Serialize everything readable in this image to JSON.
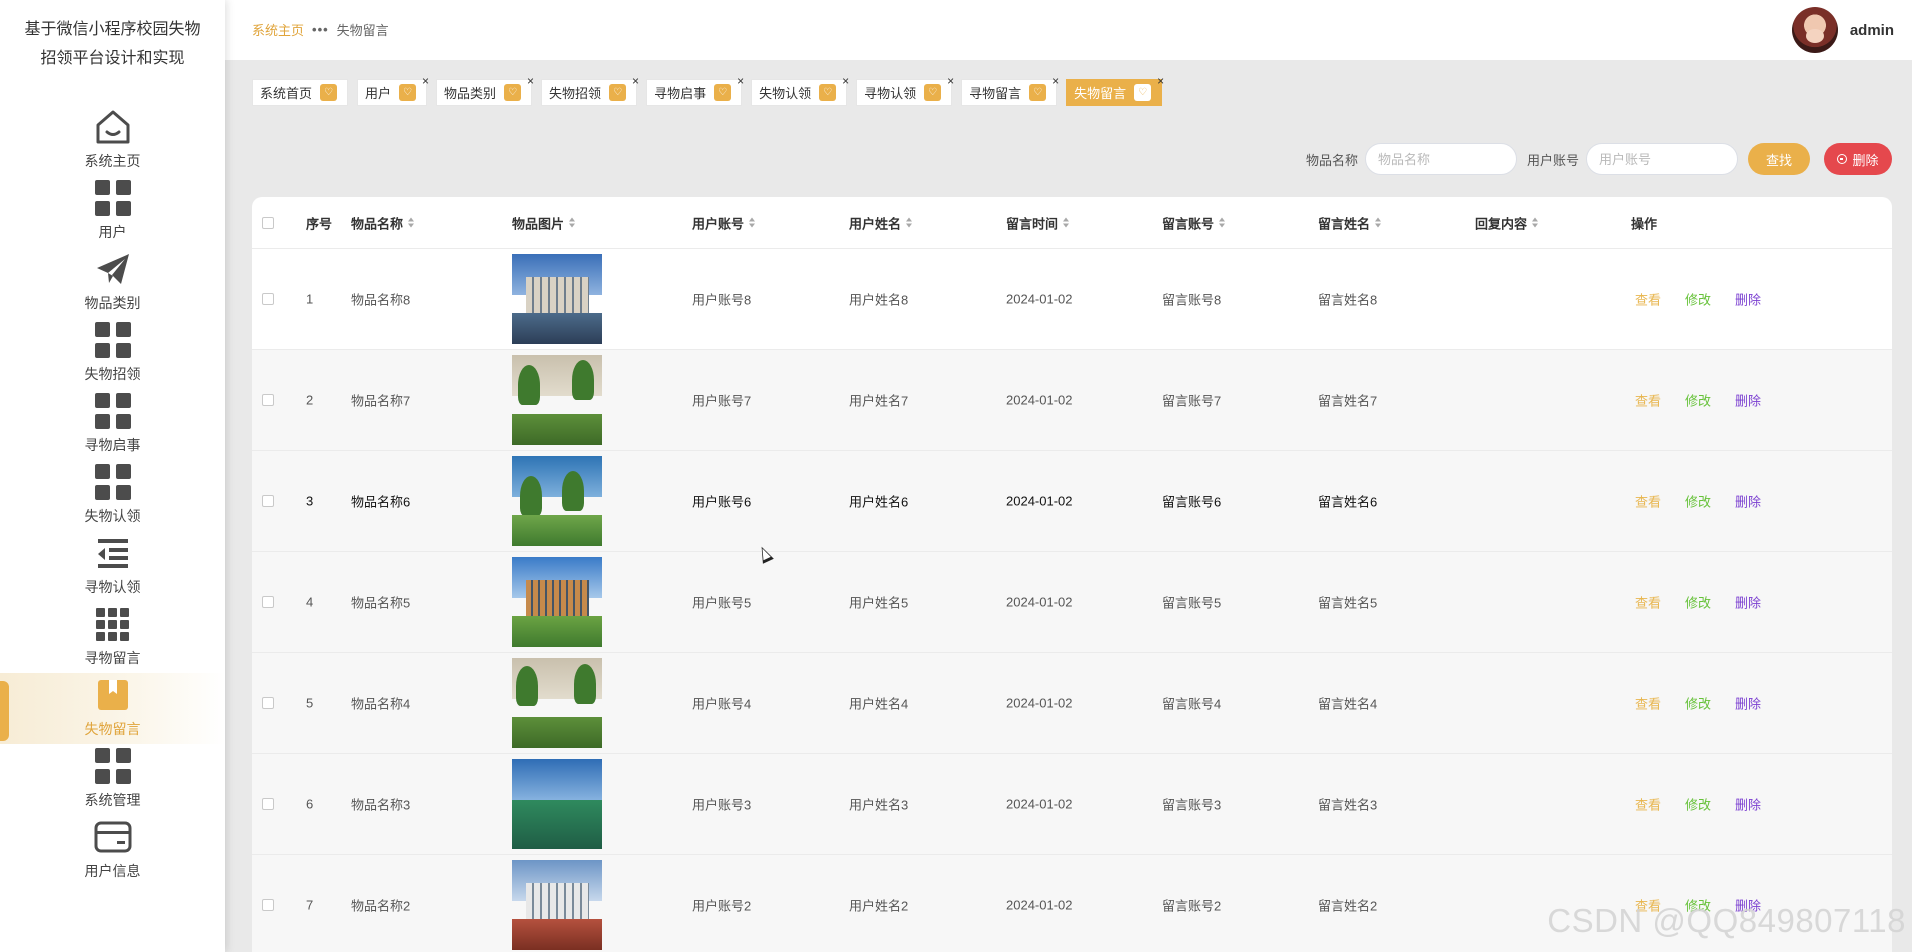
{
  "app": {
    "title_line1": "基于微信小程序校园失物",
    "title_line2": "招领平台设计和实现"
  },
  "sidebar": {
    "items": [
      {
        "label": "系统主页",
        "icon": "home-icon"
      },
      {
        "label": "用户",
        "icon": "grid-icon"
      },
      {
        "label": "物品类别",
        "icon": "paper-plane-icon"
      },
      {
        "label": "失物招领",
        "icon": "grid-icon"
      },
      {
        "label": "寻物启事",
        "icon": "grid-icon"
      },
      {
        "label": "失物认领",
        "icon": "grid-icon"
      },
      {
        "label": "寻物认领",
        "icon": "indent-list-icon"
      },
      {
        "label": "寻物留言",
        "icon": "nine-grid-icon"
      },
      {
        "label": "失物留言",
        "icon": "bookmark-box-icon",
        "active": true
      },
      {
        "label": "系统管理",
        "icon": "grid-icon"
      },
      {
        "label": "用户信息",
        "icon": "card-icon"
      }
    ]
  },
  "header": {
    "breadcrumb_home": "系统主页",
    "breadcrumb_sep": "•••",
    "breadcrumb_current": "失物留言",
    "username": "admin"
  },
  "tags": [
    {
      "label": "系统首页",
      "closable": false
    },
    {
      "label": "用户",
      "closable": true
    },
    {
      "label": "物品类别",
      "closable": true
    },
    {
      "label": "失物招领",
      "closable": true
    },
    {
      "label": "寻物启事",
      "closable": true
    },
    {
      "label": "失物认领",
      "closable": true
    },
    {
      "label": "寻物认领",
      "closable": true
    },
    {
      "label": "寻物留言",
      "closable": true
    },
    {
      "label": "失物留言",
      "closable": true,
      "active": true
    }
  ],
  "search": {
    "item_name_label": "物品名称",
    "item_name_placeholder": "物品名称",
    "user_account_label": "用户账号",
    "user_account_placeholder": "用户账号",
    "search_button": "查找",
    "delete_button": "删除"
  },
  "table": {
    "columns": [
      "序号",
      "物品名称",
      "物品图片",
      "用户账号",
      "用户姓名",
      "留言时间",
      "留言账号",
      "留言姓名",
      "回复内容",
      "操作"
    ],
    "actions": {
      "view": "查看",
      "edit": "修改",
      "delete": "删除"
    },
    "rows": [
      {
        "index": "1",
        "item_name": "物品名称8",
        "user_account": "用户账号8",
        "user_name": "用户姓名8",
        "time": "2024-01-02",
        "msg_account": "留言账号8",
        "msg_name": "留言姓名8",
        "reply": ""
      },
      {
        "index": "2",
        "item_name": "物品名称7",
        "user_account": "用户账号7",
        "user_name": "用户姓名7",
        "time": "2024-01-02",
        "msg_account": "留言账号7",
        "msg_name": "留言姓名7",
        "reply": ""
      },
      {
        "index": "3",
        "item_name": "物品名称6",
        "user_account": "用户账号6",
        "user_name": "用户姓名6",
        "time": "2024-01-02",
        "msg_account": "留言账号6",
        "msg_name": "留言姓名6",
        "reply": ""
      },
      {
        "index": "4",
        "item_name": "物品名称5",
        "user_account": "用户账号5",
        "user_name": "用户姓名5",
        "time": "2024-01-02",
        "msg_account": "留言账号5",
        "msg_name": "留言姓名5",
        "reply": ""
      },
      {
        "index": "5",
        "item_name": "物品名称4",
        "user_account": "用户账号4",
        "user_name": "用户姓名4",
        "time": "2024-01-02",
        "msg_account": "留言账号4",
        "msg_name": "留言姓名4",
        "reply": ""
      },
      {
        "index": "6",
        "item_name": "物品名称3",
        "user_account": "用户账号3",
        "user_name": "用户姓名3",
        "time": "2024-01-02",
        "msg_account": "留言账号3",
        "msg_name": "留言姓名3",
        "reply": ""
      },
      {
        "index": "7",
        "item_name": "物品名称2",
        "user_account": "用户账号2",
        "user_name": "用户姓名2",
        "time": "2024-01-02",
        "msg_account": "留言账号2",
        "msg_name": "留言姓名2",
        "reply": ""
      }
    ]
  },
  "watermark": "CSDN @QQ849807118",
  "colors": {
    "accent": "#eab04a",
    "danger": "#e5484d",
    "edit": "#67c23a",
    "delete_link": "#7b3fd1"
  }
}
